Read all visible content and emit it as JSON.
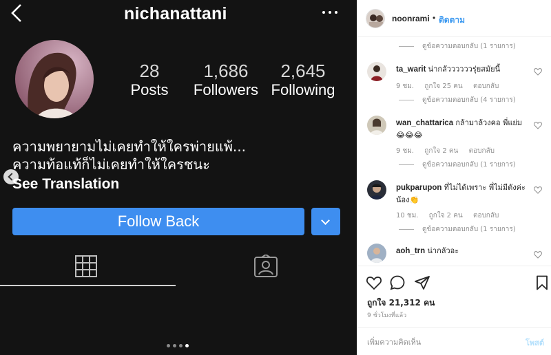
{
  "profile": {
    "username": "nichanattani",
    "stats": [
      {
        "value": "28",
        "label": "Posts"
      },
      {
        "value": "1,686",
        "label": "Followers"
      },
      {
        "value": "2,645",
        "label": "Following"
      }
    ],
    "bio_lines": [
      "ความพยายามไม่เคยทำให้ใครพ่ายแพ้...",
      "ความท้อแท้ก็ไม่เคยทำให้ใครชนะ"
    ],
    "see_translation": "See Translation",
    "follow_button": "Follow Back",
    "carousel": {
      "total": 4,
      "active": 4
    }
  },
  "post": {
    "owner": "noonrami",
    "separator": "•",
    "follow_label": "ติดตาม",
    "likes": "ถูกใจ 21,312 คน",
    "time_ago": "9 ชั่วโมงที่แล้ว",
    "comment_placeholder": "เพิ่มความคิดเห็น",
    "post_button": "โพสต์"
  },
  "comments": {
    "top_replies": "ดูข้อความตอบกลับ (1 รายการ)",
    "items": [
      {
        "user": "ta_warit",
        "text": "น่ากลัววววววรุ่ยสมัยนี้",
        "time": "9 ชม.",
        "likes": "ถูกใจ 25 คน",
        "reply": "ตอบกลับ",
        "view_replies": "ดูข้อความตอบกลับ (4 รายการ)"
      },
      {
        "user": "wan_chattarica",
        "text": "กล้ามาล้วงคอ พี่แย่ม 😂😂😂",
        "time": "9 ชม.",
        "likes": "ถูกใจ 2 คน",
        "reply": "ตอบกลับ",
        "view_replies": "ดูข้อความตอบกลับ (1 รายการ)"
      },
      {
        "user": "pukparupon",
        "text": "ที่ไม่ได้เพราะ พี่ไม่มีตังค่ะน้อง👏",
        "time": "10 ชม.",
        "likes": "ถูกใจ 2 คน",
        "reply": "ตอบกลับ",
        "view_replies": "ดูข้อความตอบกลับ (1 รายการ)"
      },
      {
        "user": "aoh_trn",
        "text": "น่ากลัวอะ"
      }
    ]
  },
  "colors": {
    "accent": "#3e8ef0",
    "link": "#3897f0",
    "dark_bg": "#131313",
    "muted": "#8e8e8e"
  },
  "icons": [
    "chevron-left-icon",
    "more-icon",
    "grid-icon",
    "tagged-icon",
    "heart-icon",
    "comment-icon",
    "share-icon",
    "bookmark-icon"
  ]
}
